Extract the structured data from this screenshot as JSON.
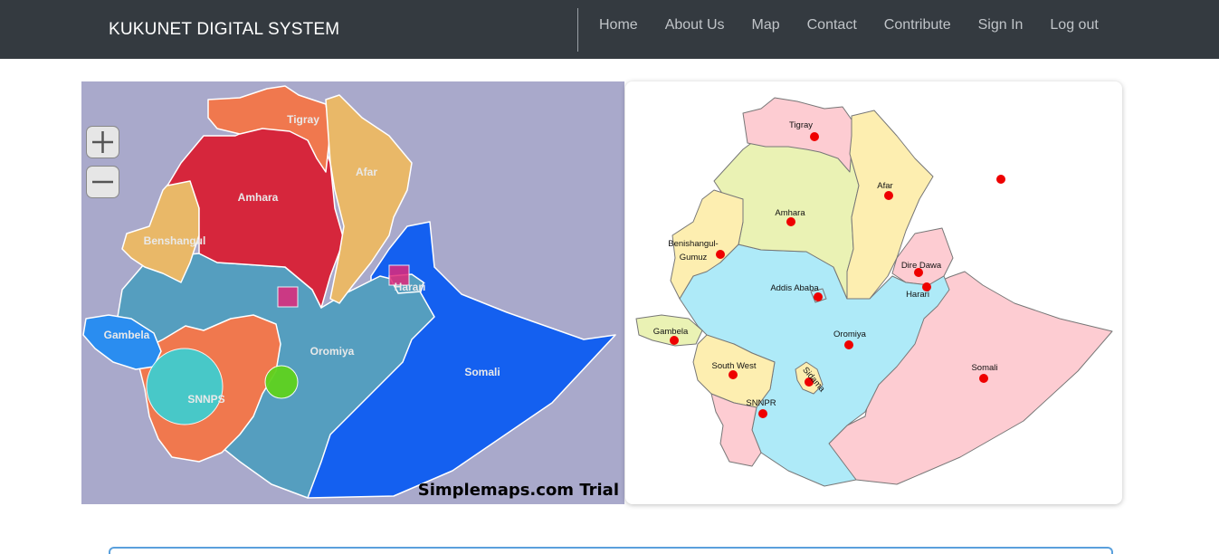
{
  "navbar": {
    "brand": "KUKUNET DIGITAL SYSTEM",
    "links": [
      "Home",
      "About Us",
      "Map",
      "Contact",
      "Contribute",
      "Sign In",
      "Log out"
    ]
  },
  "left_map": {
    "watermark": "Simplemaps.com Trial",
    "zoom_in_label": "+",
    "zoom_out_label": "−",
    "regions": {
      "tigray": "Tigray",
      "afar": "Afar",
      "amhara": "Amhara",
      "benshangul": "Benshangul",
      "gambela": "Gambela",
      "oromiya": "Oromiya",
      "somali": "Somali",
      "snnps": "SNNPS",
      "harari": "Harari"
    },
    "colors": {
      "background": "#a9a9cb",
      "tigray": "#f0784e",
      "afar": "#e9b868",
      "amhara": "#d6263c",
      "benshangul": "#e9b868",
      "gambela": "#2a8df0",
      "oromiya": "#559ebf",
      "somali": "#1460f0",
      "snnps": "#f0784e",
      "marker_circle": "#36d1d6",
      "marker_green": "#5fd21e",
      "marker_square": "#e0287a"
    }
  },
  "right_map": {
    "labels": {
      "tigray": "Tigray",
      "afar": "Afar",
      "amhara": "Amhara",
      "benishangul_1": "Benishangul-",
      "benishangul_2": "Gumuz",
      "dire_dawa": "Dire Dawa",
      "harari": "Harari",
      "addis_ababa": "Addis Ababa",
      "gambela": "Gambela",
      "oromiya": "Oromiya",
      "south_west": "South West",
      "sidama": "Sidama",
      "somali": "Somali",
      "snnpr": "SNNPR"
    },
    "colors": {
      "pink": "#fdccd2",
      "yellow": "#fdeeb0",
      "lightgreen": "#eaf2b4",
      "blue": "#aeeaf8",
      "dot": "#ee0000"
    }
  }
}
